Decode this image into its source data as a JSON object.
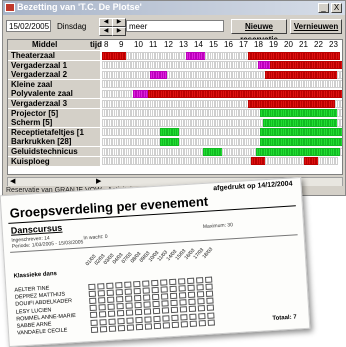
{
  "window": {
    "title": "Bezetting van 'T.C. De Plotse'",
    "minimize": "_",
    "close": "X"
  },
  "toolbar": {
    "date": "15/02/2005",
    "day": "Dinsdag",
    "search_value": "meer",
    "new_reservation": "Nieuwe reservatie",
    "refresh": "Vernieuwen"
  },
  "grid": {
    "header_left": "Middel",
    "header_tijd": "tijd",
    "hours": [
      "8",
      "9",
      "10",
      "11",
      "12",
      "13",
      "14",
      "15",
      "16",
      "17",
      "18",
      "19",
      "20",
      "21",
      "22",
      "23"
    ],
    "rows": [
      {
        "name": "Theaterzaal",
        "cells": "rrrrrrrrrr.........................mmmmmmmm..................rrrrrrrrrrrrrrrrrrrrrrrrrrrrrrrrrrrrrr"
      },
      {
        "name": "Vergaderzaal 1",
        "cells": ".................................................................mmmmmrrrrrrrrrrrrrrrrrrrrrrrrrrrrrrr"
      },
      {
        "name": "Vergaderzaal 2",
        "cells": "....................mmmmmmm.........................................rrrrrrrrrrrrrrrrrrrrrrrrrrrrrr..."
      },
      {
        "name": "Kleine zaal",
        "cells": "...................................................................................................."
      },
      {
        "name": "Polyvalente zaal",
        "cells": ".............mmmmmmrrrrrrrrrrrrrrrrrrrrrrrrrrrrrrrrrrrrrrrrrrrrrrrrrrrrrrrrrrrrrrrrrrrrrrrrrrrrrrrrrrr"
      },
      {
        "name": "Vergaderzaal 3",
        "cells": ".............................................................rrrrrrrrrrrrrrrrrrrrrrrrrrrrrrrrrrrr..."
      },
      {
        "name": "Projector [5]",
        "cells": "..................................................................gggggggggggggggggggggggggggggggg.."
      },
      {
        "name": "Scherm [5]",
        "cells": "...................................................................ggggggggggggggggggggggggggggggg.."
      },
      {
        "name": "Receptietafeltjes [1",
        "cells": "........................gggggggg..................................gggggggggggggggggggggggggggggggggg"
      },
      {
        "name": "Barkrukken [28]",
        "cells": "........................gggggggg..................................gggggggggggggggggggggggggggggggggg"
      },
      {
        "name": "Geluidstechnicus",
        "cells": "..........................................gggggggg..............ggggggggggggggggggggggggggggggggggg."
      },
      {
        "name": "Kuisploeg",
        "cells": "..............................................................rrrrrr................rrrrrr........"
      }
    ]
  },
  "status": {
    "text": "Reservatie van GRANJE VOW - Activiteit: ..."
  },
  "report": {
    "printed": "afgedrukt op 14/12/2004",
    "title": "Groepsverdeling per evenement",
    "event": "Danscursus",
    "ingeschreven": "Ingeschreven: 14",
    "wacht": "In wacht: 0",
    "maximum": "Maximum: 30",
    "periode": "Periode: 1/03/2005 - 15/03/2005",
    "group": "Klassieke dans",
    "dates": [
      "01/03",
      "02/03",
      "03/03",
      "04/03",
      "07/03",
      "08/03",
      "09/03",
      "10/03",
      "11/03",
      "14/03",
      "15/03",
      "16/03",
      "17/03",
      "18/03"
    ],
    "names": [
      "AELTER TINE",
      "DEPREZ MATTHIJS",
      "DOUIFI ABDELKADER",
      "LESY LUCIEN",
      "ROMMEL ANNE-MARIE",
      "SABBE ARNE",
      "VANDAELE CECILE"
    ],
    "total": "Totaal: 7"
  },
  "colors": {
    "reserved": "#dd1111",
    "available": "#22dd33",
    "option": "#dd22dd"
  }
}
